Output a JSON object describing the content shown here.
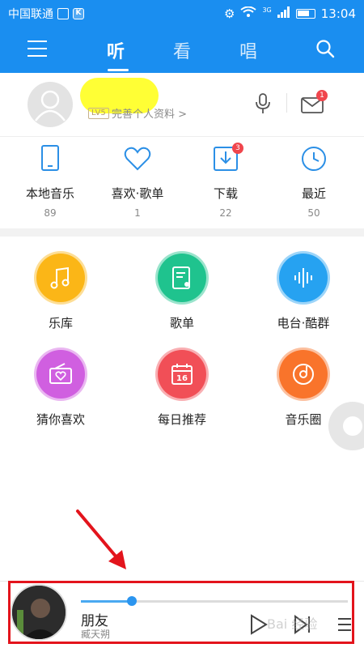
{
  "status_bar": {
    "carrier": "中国联通",
    "net_type": "3G",
    "time": "13:04"
  },
  "nav": {
    "tabs": [
      {
        "label": "听",
        "active": true
      },
      {
        "label": "看",
        "active": false
      },
      {
        "label": "唱",
        "active": false
      }
    ],
    "icons": [
      "menu-icon",
      "search-icon"
    ]
  },
  "profile": {
    "vip_tag": "LV5",
    "link_text": "完善个人资料 >",
    "mail_badge": "1",
    "icons": [
      "avatar",
      "microphone-icon",
      "mail-icon"
    ]
  },
  "stats": [
    {
      "label": "本地音乐",
      "count": "89",
      "icon": "phone-icon"
    },
    {
      "label": "喜欢·歌单",
      "count": "1",
      "icon": "heart-icon"
    },
    {
      "label": "下载",
      "count": "22",
      "icon": "download-icon",
      "badge": "3"
    },
    {
      "label": "最近",
      "count": "50",
      "icon": "clock-icon"
    }
  ],
  "grid": [
    {
      "label": "乐库",
      "color": "#fbb617",
      "icon": "music-note-icon"
    },
    {
      "label": "歌单",
      "color": "#1fc38e",
      "icon": "playlist-icon"
    },
    {
      "label": "电台·酷群",
      "color": "#26a2f1",
      "icon": "radio-wave-icon"
    },
    {
      "label": "猜你喜欢",
      "color": "#d05fe0",
      "icon": "radio-heart-icon"
    },
    {
      "label": "每日推荐",
      "color": "#f14f57",
      "icon": "calendar-icon"
    },
    {
      "label": "音乐圈",
      "color": "#f9742b",
      "icon": "disc-icon"
    }
  ],
  "player": {
    "title": "朋友",
    "artist": "臧天朔",
    "progress": 0.19,
    "icons": [
      "play-icon",
      "next-icon",
      "playlist-menu-icon"
    ]
  },
  "annotation": {
    "arrow_color": "#e3141c",
    "highlight_color": "#e3141c"
  },
  "watermark": "Bai 经验"
}
